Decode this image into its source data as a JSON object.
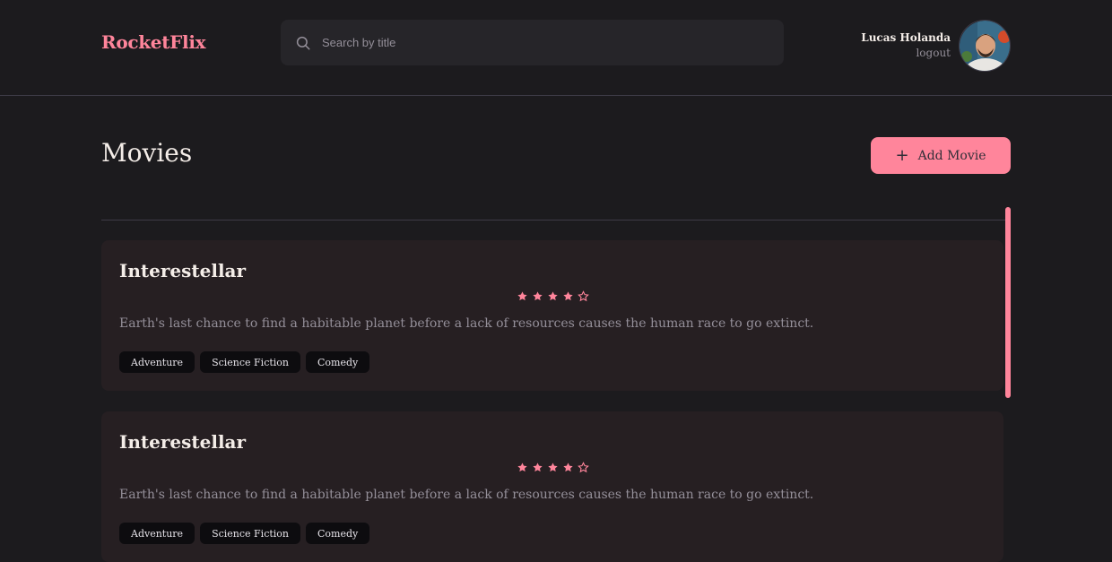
{
  "header": {
    "logo": "RocketFlix",
    "search": {
      "placeholder": "Search by title",
      "value": ""
    },
    "user": {
      "name": "Lucas Holanda",
      "logout_label": "logout"
    }
  },
  "page": {
    "title": "Movies",
    "add_button_label": "Add Movie"
  },
  "movies": [
    {
      "title": "Interestellar",
      "rating": 4,
      "max_rating": 5,
      "description": "Earth's last chance to find a habitable planet before a lack of resources causes the human race to go extinct.",
      "tags": [
        "Adventure",
        "Science Fiction",
        "Comedy"
      ]
    },
    {
      "title": "Interestellar",
      "rating": 4,
      "max_rating": 5,
      "description": "Earth's last chance to find a habitable planet before a lack of resources causes the human race to go extinct.",
      "tags": [
        "Adventure",
        "Science Fiction",
        "Comedy"
      ]
    }
  ],
  "colors": {
    "background": "#1c1b1e",
    "accent": "#ff859b",
    "card": "#261f22",
    "tag": "#0d0c0f",
    "muted_text": "#948f99"
  },
  "icons": {
    "search": "search-icon",
    "plus": "plus-icon",
    "star_filled": "star-filled-icon",
    "star_empty": "star-empty-icon"
  }
}
